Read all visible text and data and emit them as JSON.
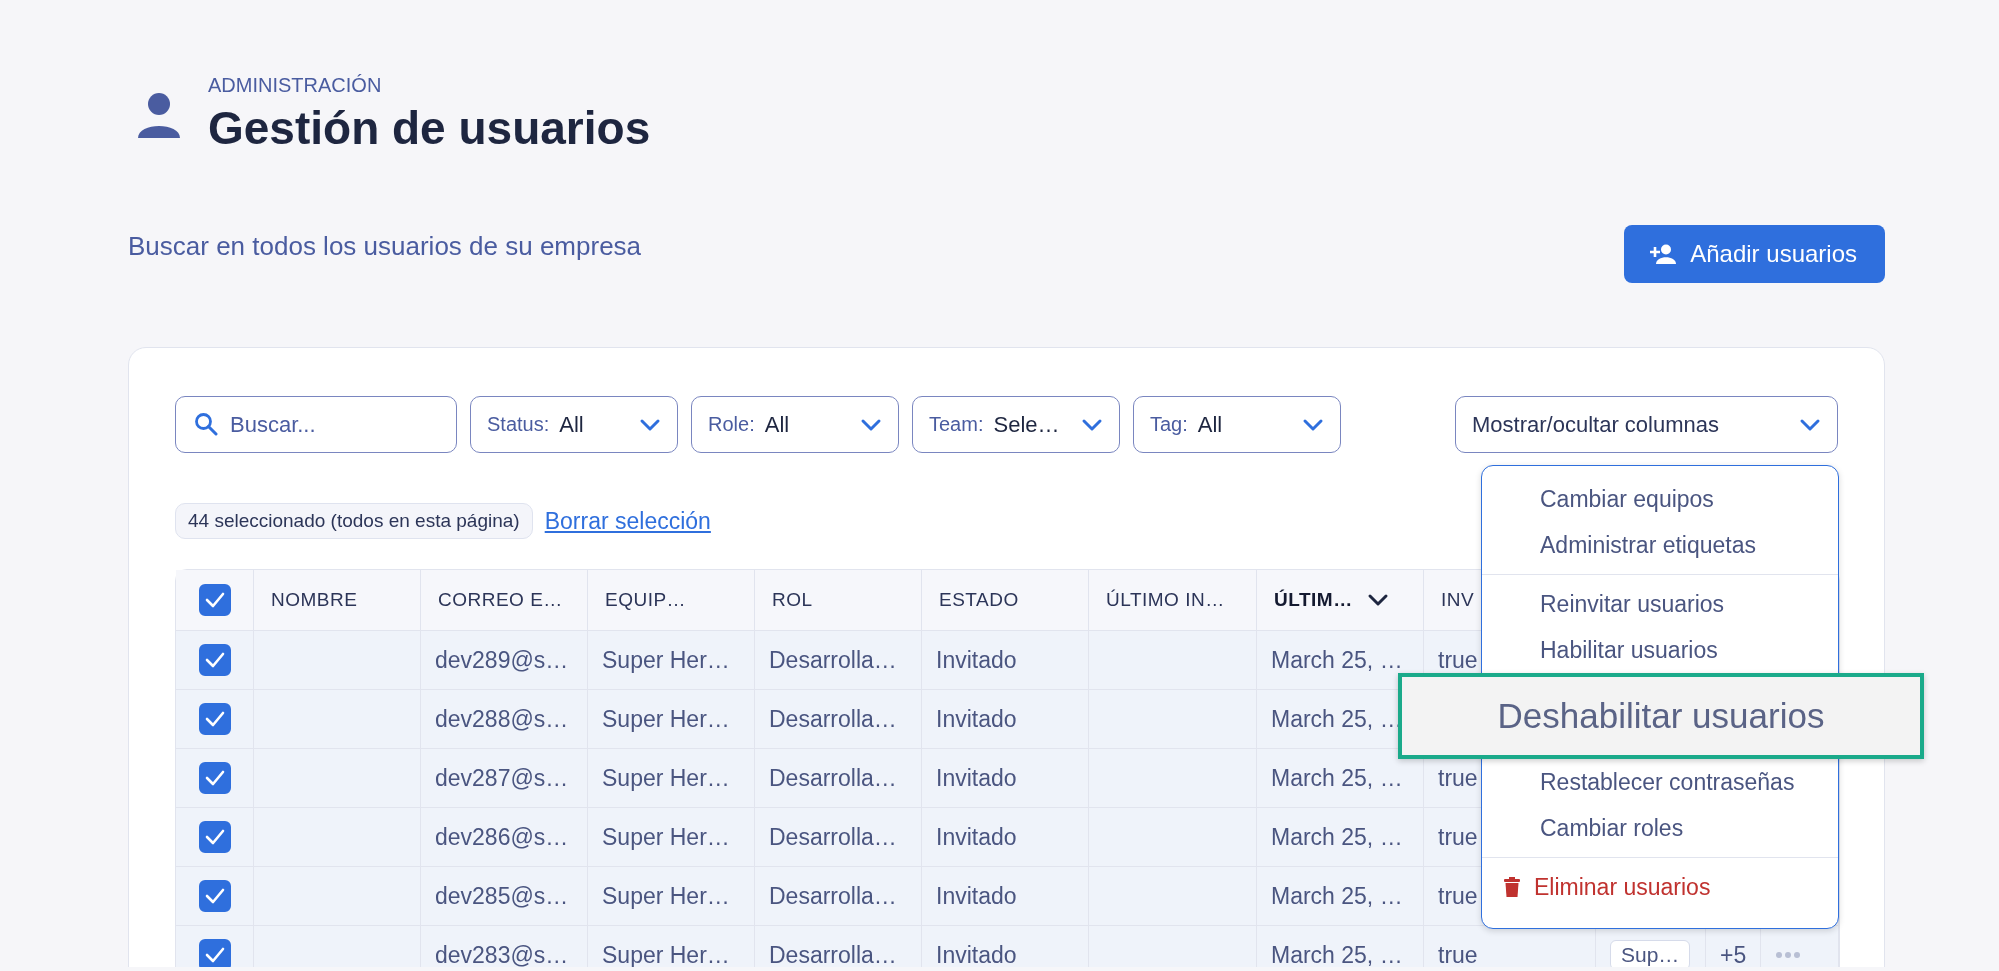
{
  "header": {
    "eyebrow": "ADMINISTRACIÓN",
    "title": "Gestión de usuarios",
    "subtitle": "Buscar en todos los usuarios de su empresa"
  },
  "add_button": {
    "label": "Añadir usuarios"
  },
  "filters": {
    "search": {
      "placeholder": "Buscar..."
    },
    "dropdowns": [
      {
        "label": "Status:",
        "value": "All"
      },
      {
        "label": "Role:",
        "value": "All"
      },
      {
        "label": "Team:",
        "value": "Sele…"
      },
      {
        "label": "Tag:",
        "value": "All"
      }
    ],
    "columns_button": "Mostrar/ocultar columnas"
  },
  "selection": {
    "summary": "44 seleccionado (todos en esta página)",
    "clear_link": "Borrar selección"
  },
  "table": {
    "select_all_checked": true,
    "columns": [
      {
        "label": "NOMBRE",
        "sorted": false
      },
      {
        "label": "CORREO E…",
        "sorted": false
      },
      {
        "label": "EQUIP…",
        "sorted": false
      },
      {
        "label": "ROL",
        "sorted": false
      },
      {
        "label": "ESTADO",
        "sorted": false
      },
      {
        "label": "ÚLTIMO IN…",
        "sorted": false
      },
      {
        "label": "ÚLTIM…",
        "sorted": true
      },
      {
        "label": "INV",
        "sorted": false
      }
    ],
    "rows": [
      {
        "checked": true,
        "email": "dev289@s…",
        "team": "Super Her…",
        "role": "Desarrolla…",
        "status": "Invitado",
        "date": "March 25, …",
        "invited": "true"
      },
      {
        "checked": true,
        "email": "dev288@s…",
        "team": "Super Her…",
        "role": "Desarrolla…",
        "status": "Invitado",
        "date": "March 25, …"
      },
      {
        "checked": true,
        "email": "dev287@s…",
        "team": "Super Her…",
        "role": "Desarrolla…",
        "status": "Invitado",
        "date": "March 25, …",
        "invited": "true"
      },
      {
        "checked": true,
        "email": "dev286@s…",
        "team": "Super Her…",
        "role": "Desarrolla…",
        "status": "Invitado",
        "date": "March 25, …",
        "invited": "true"
      },
      {
        "checked": true,
        "email": "dev285@s…",
        "team": "Super Her…",
        "role": "Desarrolla…",
        "status": "Invitado",
        "date": "March 25, …",
        "invited": "true"
      },
      {
        "checked": true,
        "email": "dev283@s…",
        "team": "Super Her…",
        "role": "Desarrolla…",
        "status": "Invitado",
        "date": "March 25, …",
        "invited": "true",
        "tag": "Sup…",
        "extra": "+5",
        "more": true
      }
    ]
  },
  "menu": {
    "items": [
      {
        "kind": "action",
        "label": "Cambiar equipos"
      },
      {
        "kind": "action",
        "label": "Administrar etiquetas"
      },
      {
        "kind": "divider"
      },
      {
        "kind": "action",
        "label": "Reinvitar usuarios"
      },
      {
        "kind": "action",
        "label": "Habilitar usuarios"
      },
      {
        "kind": "hidden"
      },
      {
        "kind": "action",
        "label": "Restablecer contraseñas"
      },
      {
        "kind": "action",
        "label": "Cambiar roles"
      },
      {
        "kind": "divider"
      },
      {
        "kind": "danger",
        "label": "Eliminar usuarios"
      }
    ]
  },
  "callout": {
    "label": "Deshabilitar usuarios"
  }
}
